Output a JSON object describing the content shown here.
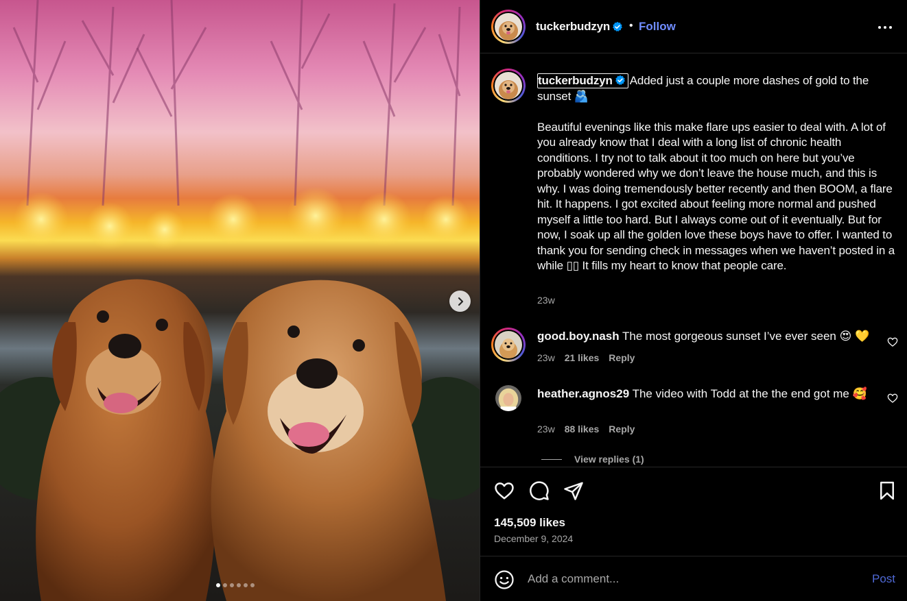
{
  "post": {
    "username": "tuckerbudzyn",
    "follow_label": "Follow",
    "bullet": "•",
    "caption_lead": "Added just a couple more dashes of gold to the sunset 🫂",
    "caption_body": "Beautiful evenings like this make flare ups easier to deal with. A lot of you already know that I deal with a long list of chronic health conditions. I try not to talk about it too much on here but you’ve probably wondered why we don’t leave the house much, and this is why. I was doing tremendously better recently and then BOOM, a flare hit. It happens. I got excited about feeling more normal and pushed myself a little too hard. But I always come out of it eventually. But for now, I soak up all the golden love these boys have to offer. I wanted to thank you for sending check in messages when we haven’t posted in a while ▯▯ It fills my heart to know that people care.",
    "caption_time": "23w",
    "likes": "145,509 likes",
    "date": "December 9, 2024",
    "carousel_position": 1,
    "carousel_count": 6
  },
  "comments": [
    {
      "username": "good.boy.nash",
      "text": "The most gorgeous sunset I’ve ever seen 😍 💛",
      "time": "23w",
      "likes": "21 likes",
      "reply_label": "Reply"
    },
    {
      "username": "heather.agnos29",
      "text": "The video with Todd at the the end got me 🥰",
      "time": "23w",
      "likes": "88 likes",
      "reply_label": "Reply"
    }
  ],
  "view_replies": "View replies (1)",
  "composer": {
    "placeholder": "Add a comment...",
    "post_label": "Post"
  },
  "colors": {
    "accent": "#708dff",
    "post_button": "#4f69d6",
    "muted_text": "#a8a8a8",
    "verified": "#0095f6"
  }
}
